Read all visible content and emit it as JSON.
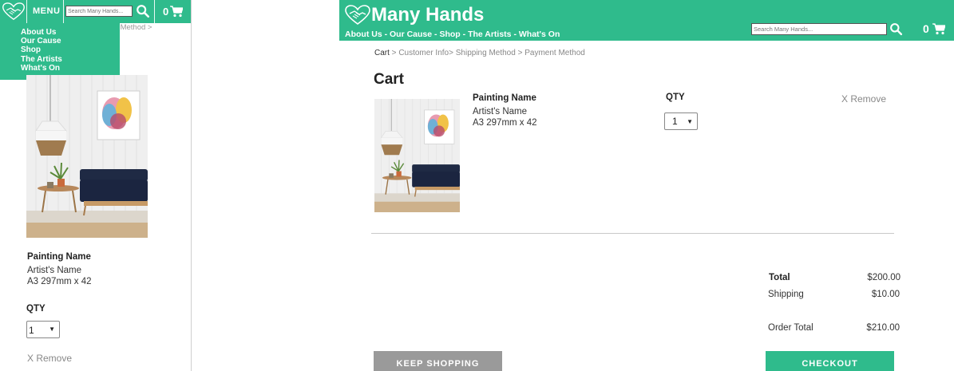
{
  "brand": {
    "name": "Many Hands",
    "accent": "#2fbb8c",
    "logo_icon": "handshake-heart-icon"
  },
  "mobile": {
    "menu_label": "MENU",
    "search_placeholder": "Search Many Hands...",
    "cart_count": "0",
    "breadcrumb_partial": "ping Method >",
    "dropdown_items": [
      "About Us",
      "Our Cause",
      "Shop",
      "The Artists",
      "What's On"
    ],
    "product": {
      "name": "Painting Name",
      "artist": "Artist's Name",
      "size": "A3 297mm x 42"
    },
    "qty_label": "QTY",
    "qty_value": "1",
    "remove_label": "X Remove"
  },
  "desktop": {
    "title": "Many Hands",
    "nav": [
      "About Us",
      "Our Cause",
      "Shop",
      "The Artists",
      "What's On"
    ],
    "nav_sep": " - ",
    "search_placeholder": "Search Many Hands...",
    "cart_count": "0",
    "breadcrumb": {
      "b1": "Cart",
      "s1": " > ",
      "b2": "Customer Info",
      "s2": "> ",
      "b3": "Shipping Method",
      "s3": " > ",
      "b4": "Payment Method"
    },
    "cart_title": "Cart",
    "product": {
      "name": "Painting Name",
      "artist": "Artist's Name",
      "size": "A3 297mm x 42"
    },
    "qty_label": "QTY",
    "qty_value": "1",
    "remove_label": "X Remove",
    "summary": {
      "total_label": "Total",
      "total_value": "$200.00",
      "shipping_label": "Shipping",
      "shipping_value": "$10.00",
      "order_total_label": "Order Total",
      "order_total_value": "$210.00"
    },
    "keep_shopping_label": "KEEP SHOPPING",
    "checkout_label": "CHECKOUT"
  }
}
